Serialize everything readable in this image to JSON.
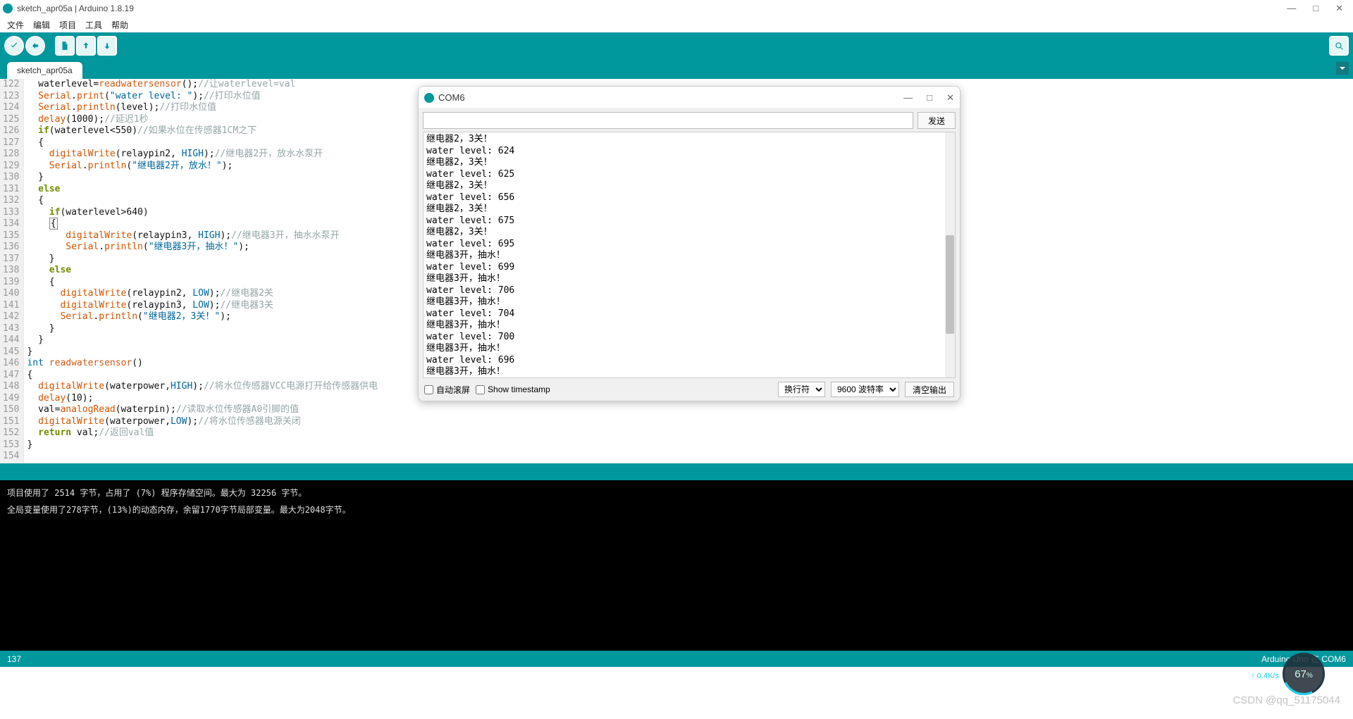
{
  "window": {
    "title": "sketch_apr05a | Arduino 1.8.19"
  },
  "menu": [
    "文件",
    "编辑",
    "项目",
    "工具",
    "帮助"
  ],
  "tab": {
    "label": "sketch_apr05a"
  },
  "code_lines": [
    {
      "n": 122,
      "html": "  waterlevel=<span class='k-red'>readwatersensor</span>();<span class='k-gray'>//让waterlevel=val</span>"
    },
    {
      "n": 123,
      "html": "  <span class='k-orange'>Serial</span>.<span class='k-orange'>print</span>(<span class='k-string'>\"water level: \"</span>);<span class='k-gray'>//打印水位值</span>"
    },
    {
      "n": 124,
      "html": "  <span class='k-orange'>Serial</span>.<span class='k-orange'>println</span>(level);<span class='k-gray'>//打印水位值</span>"
    },
    {
      "n": 125,
      "html": "  <span class='k-orange'>delay</span>(1000);<span class='k-gray'>//延迟1秒</span>"
    },
    {
      "n": 126,
      "html": "  <span class='k-green'>if</span>(waterlevel&lt;550)<span class='k-gray'>//如果水位在传感器1CM之下</span>"
    },
    {
      "n": 127,
      "html": "  {"
    },
    {
      "n": 128,
      "html": "    <span class='k-orange'>digitalWrite</span>(relaypin2, <span class='k-blue'>HIGH</span>);<span class='k-gray'>//继电器2开，放水水泵开</span>"
    },
    {
      "n": 129,
      "html": "    <span class='k-orange'>Serial</span>.<span class='k-orange'>println</span>(<span class='k-string'>\"继电器2开，放水！\"</span>);"
    },
    {
      "n": 130,
      "html": "  }"
    },
    {
      "n": 131,
      "html": "  <span class='k-green'>else</span>"
    },
    {
      "n": 132,
      "html": "  {"
    },
    {
      "n": 133,
      "html": "    <span class='k-green'>if</span>(waterlevel&gt;640)"
    },
    {
      "n": 134,
      "html": "    <span class='cursor-box'>{</span>"
    },
    {
      "n": 135,
      "html": "       <span class='k-orange'>digitalWrite</span>(relaypin3, <span class='k-blue'>HIGH</span>);<span class='k-gray'>//继电器3开，抽水水泵开</span>"
    },
    {
      "n": 136,
      "html": "       <span class='k-orange'>Serial</span>.<span class='k-orange'>println</span>(<span class='k-string'>\"继电器3开，抽水！\"</span>);"
    },
    {
      "n": 137,
      "html": "    }"
    },
    {
      "n": 138,
      "html": "    <span class='k-green'>else</span>"
    },
    {
      "n": 139,
      "html": "    {"
    },
    {
      "n": 140,
      "html": "      <span class='k-orange'>digitalWrite</span>(relaypin2, <span class='k-blue'>LOW</span>);<span class='k-gray'>//继电器2关</span>"
    },
    {
      "n": 141,
      "html": "      <span class='k-orange'>digitalWrite</span>(relaypin3, <span class='k-blue'>LOW</span>);<span class='k-gray'>//继电器3关</span>"
    },
    {
      "n": 142,
      "html": "      <span class='k-orange'>Serial</span>.<span class='k-orange'>println</span>(<span class='k-string'>\"继电器2，3关！\"</span>);"
    },
    {
      "n": 143,
      "html": "    }"
    },
    {
      "n": 144,
      "html": "  }"
    },
    {
      "n": 145,
      "html": ""
    },
    {
      "n": 146,
      "html": "}"
    },
    {
      "n": 147,
      "html": "<span class='k-blue'>int</span> <span class='k-red'>readwatersensor</span>()"
    },
    {
      "n": 148,
      "html": "{"
    },
    {
      "n": 149,
      "html": "  <span class='k-orange'>digitalWrite</span>(waterpower,<span class='k-blue'>HIGH</span>);<span class='k-gray'>//将水位传感器VCC电源打开给传感器供电</span>"
    },
    {
      "n": 150,
      "html": "  <span class='k-orange'>delay</span>(10);"
    },
    {
      "n": 151,
      "html": "  val=<span class='k-orange'>analogRead</span>(waterpin);<span class='k-gray'>//读取水位传感器A0引脚的值</span>"
    },
    {
      "n": 152,
      "html": "  <span class='k-orange'>digitalWrite</span>(waterpower,<span class='k-blue'>LOW</span>);<span class='k-gray'>//将水位传感器电源关闭</span>"
    },
    {
      "n": 153,
      "html": "  <span class='k-green'>return</span> val;<span class='k-gray'>//返回val值</span>"
    },
    {
      "n": 154,
      "html": "}"
    }
  ],
  "console_lines": [
    "项目使用了 2514 字节，占用了 (7%) 程序存储空间。最大为 32256 字节。",
    "全局变量使用了278字节，(13%)的动态内存，余留1770字节局部变量。最大为2048字节。"
  ],
  "status": {
    "left": "137",
    "right": "Arduino Uno 在 COM6"
  },
  "serial": {
    "title": "COM6",
    "send_btn": "发送",
    "lines": [
      "继电器2，3关！",
      "water level: 624",
      "继电器2，3关！",
      "water level: 625",
      "继电器2，3关！",
      "water level: 656",
      "继电器2，3关！",
      "water level: 675",
      "继电器2，3关！",
      "water level: 695",
      "继电器3开，抽水！",
      "water level: 699",
      "继电器3开，抽水！",
      "water level: 706",
      "继电器3开，抽水！",
      "water level: 704",
      "继电器3开，抽水！",
      "water level: 700",
      "继电器3开，抽水！",
      "water level: 696",
      "继电器3开，抽水！"
    ],
    "autoscroll": "自动滚屏",
    "timestamp": "Show timestamp",
    "line_ending": "换行符",
    "baud": "9600 波特率",
    "clear": "清空输出"
  },
  "gauge": {
    "pct": "67",
    "unit": "%",
    "net": "↑ 0.4K/s"
  },
  "watermark": "CSDN @qq_51175044"
}
